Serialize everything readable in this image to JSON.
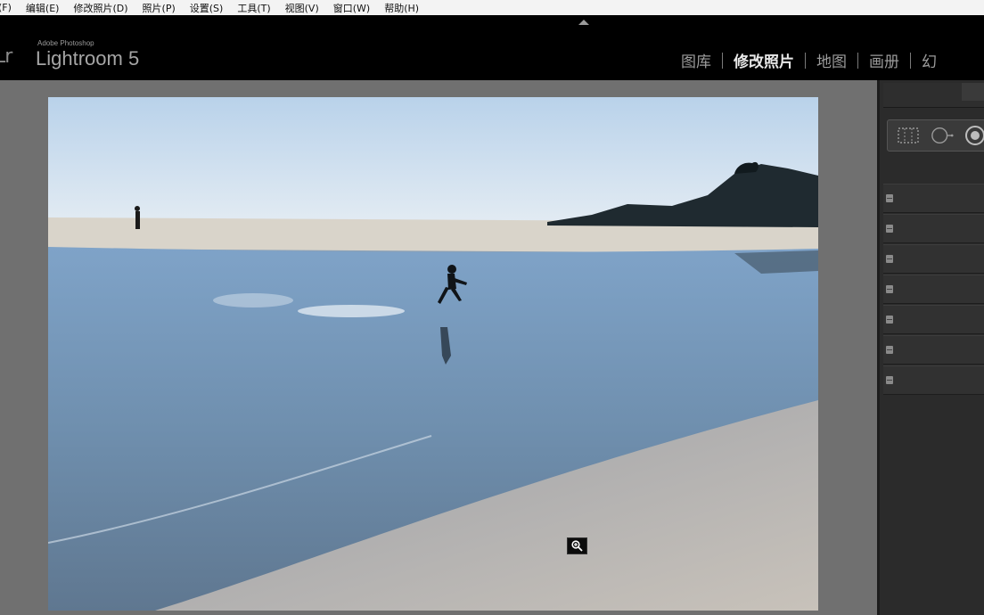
{
  "menubar": {
    "items": [
      "(F)",
      "编辑(E)",
      "修改照片(D)",
      "照片(P)",
      "设置(S)",
      "工具(T)",
      "视图(V)",
      "窗口(W)",
      "帮助(H)"
    ]
  },
  "brand": {
    "logo": "Lr",
    "vendor": "Adobe Photoshop",
    "product": "Lightroom 5"
  },
  "modules": {
    "items": [
      "图库",
      "修改照片",
      "地图",
      "画册",
      "幻"
    ],
    "active": "修改照片"
  },
  "right_panel": {
    "tools": [
      "crop-overlay-icon",
      "spot-removal-icon",
      "red-eye-icon"
    ],
    "panel_count": 7
  },
  "colors": {
    "accent_active": "#e8e8e8",
    "module_inactive": "#9c9c9c",
    "panel_bg": "#2b2b2b",
    "canvas_bg": "#707070"
  },
  "icons": {
    "zoom": "zoom-in-icon",
    "panel_switch": "panel-switch-icon",
    "collapse": "collapse-arrow-icon"
  }
}
